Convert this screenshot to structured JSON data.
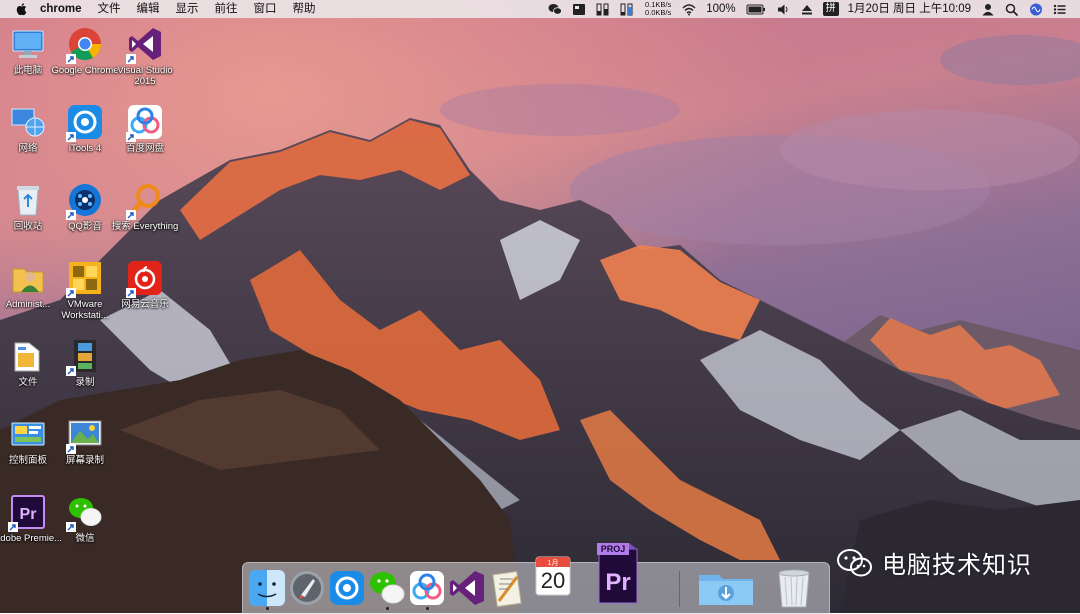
{
  "menubar": {
    "app_name": "chrome",
    "menus": [
      "文件",
      "编辑",
      "显示",
      "前往",
      "窗口",
      "帮助"
    ],
    "net_up": "0.1KB/s",
    "net_down": "0.0KB/s",
    "battery": "100%",
    "input_method": "拼",
    "datetime": "1月20日 周日 上午10:09"
  },
  "desktop_icons": [
    {
      "label": "此电脑"
    },
    {
      "label": "Google Chrome"
    },
    {
      "label": "Visual Studio 2015"
    },
    {
      "label": "网络"
    },
    {
      "label": "iTools 4"
    },
    {
      "label": "百度网盘"
    },
    {
      "label": "回收站"
    },
    {
      "label": "QQ影音"
    },
    {
      "label": "搜索 Everything"
    },
    {
      "label": "Administ..."
    },
    {
      "label": "VMware Workstati..."
    },
    {
      "label": "网易云音乐"
    },
    {
      "label": "文件"
    },
    {
      "label": "录制"
    },
    {
      "label": "控制面板"
    },
    {
      "label": "屏幕录制"
    },
    {
      "label": "Adobe Premie..."
    },
    {
      "label": "微信"
    }
  ],
  "dock": {
    "calendar_month": "1月",
    "calendar_day": "20",
    "premiere_badge": "PROJ",
    "premiere_text": "Pr"
  },
  "watermark": {
    "text": "电脑技术知识"
  }
}
